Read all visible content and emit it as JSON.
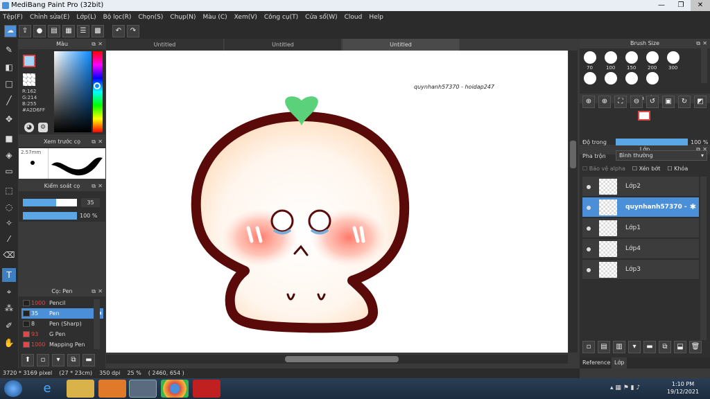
{
  "titlebar": {
    "title": "MediBang Paint Pro (32bit)",
    "min": "—",
    "max": "❐",
    "close": "✕"
  },
  "menu": [
    "Tệp(F)",
    "Chỉnh sửa(E)",
    "Lớp(L)",
    "Bộ lọc(R)",
    "Chọn(S)",
    "Chụp(N)",
    "Màu (C)",
    "Xem(V)",
    "Công cụ(T)",
    "Cửa sổ(W)",
    "Cloud",
    "Help"
  ],
  "tabs": [
    "Untitled",
    "Untitled",
    "Untitled"
  ],
  "color_panel": {
    "title": "Màu",
    "r": "R:162",
    "g": "G:214",
    "b": "B:255",
    "hex": "#A2D6FF",
    "primary_color": "#A2D6FF"
  },
  "preview_panel": {
    "title": "Xem trước cọ",
    "size": "2.57mm"
  },
  "brush_control": {
    "title": "Kiểm soát cọ",
    "size_value": "35",
    "opacity_value": "100 %"
  },
  "brush_list": {
    "title": "Cọ: Pen",
    "items": [
      {
        "size": "1000",
        "name": "Pencil",
        "selected": false
      },
      {
        "size": "35",
        "name": "Pen",
        "selected": true
      },
      {
        "size": "8",
        "name": "Pen (Sharp)",
        "selected": false
      },
      {
        "size": "93",
        "name": "G Pen",
        "selected": false
      },
      {
        "size": "1000",
        "name": "Mapping Pen",
        "selected": false
      }
    ]
  },
  "brush_size": {
    "title": "Brush Size",
    "sizes": [
      "70",
      "100",
      "150",
      "200",
      "300"
    ]
  },
  "navigator": {
    "title": "Hoa tiêu"
  },
  "layers": {
    "title": "Lớp",
    "opacity_label": "Độ trong",
    "opacity_value": "100 %",
    "blend_label": "Pha trộn",
    "blend_value": "Bình thường",
    "protect_alpha": "Bảo vệ alpha",
    "clipping": "Xén bớt",
    "lock": "Khóa",
    "items": [
      {
        "name": "Lớp2",
        "selected": false
      },
      {
        "name": "quynhanh57370 -",
        "selected": true
      },
      {
        "name": "Lớp1",
        "selected": false
      },
      {
        "name": "Lớp4",
        "selected": false
      },
      {
        "name": "Lớp3",
        "selected": false
      }
    ],
    "tab_reference": "Reference",
    "tab_layer": "Lớp"
  },
  "canvas": {
    "watermark": "quynhanh57370 - hoidap247"
  },
  "status": {
    "pixel": "3720 * 3169 pixel",
    "cm": "(27 * 23cm)",
    "dpi": "350 dpi",
    "zoom": "25 %",
    "coords": "( 2460, 654 )"
  },
  "taskbar": {
    "time": "1:10 PM",
    "date": "19/12/2021"
  }
}
